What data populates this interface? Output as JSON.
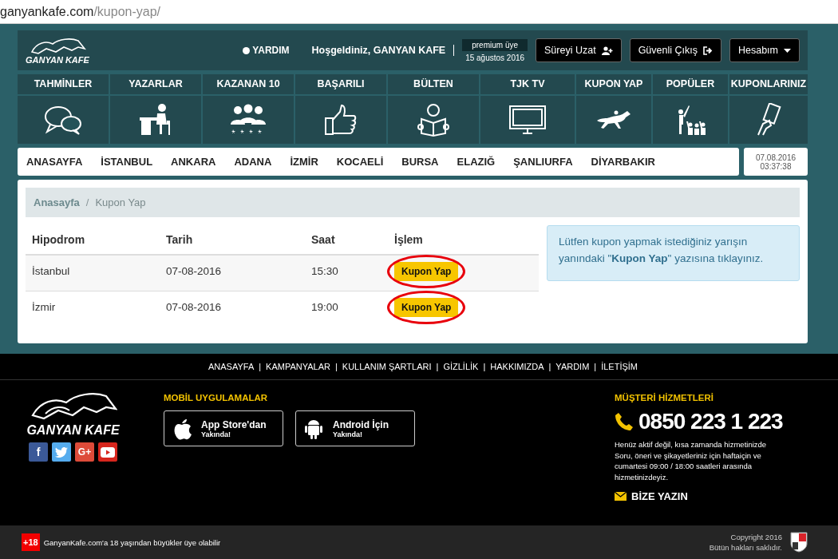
{
  "address_bar": {
    "domain": "ganyankafe.com",
    "path": "/kupon-yap/"
  },
  "header": {
    "logo": "GANYAN KAFE",
    "help": "YARDIM",
    "welcome": "Hoşgeldiniz, GANYAN KAFE",
    "membership": {
      "plan": "premium üye",
      "expires": "15 ağustos 2016"
    },
    "buttons": [
      {
        "label": "Süreyi Uzat",
        "kind": "user-plus"
      },
      {
        "label": "Güvenli Çıkış",
        "kind": "sign-out"
      },
      {
        "label": "Hesabım",
        "kind": "dropdown"
      }
    ]
  },
  "categories": [
    {
      "label": "TAHMİNLER",
      "kind": "chat"
    },
    {
      "label": "YAZARLAR",
      "kind": "writer"
    },
    {
      "label": "KAZANAN 10",
      "kind": "group"
    },
    {
      "label": "BAŞARILI",
      "kind": "thumb"
    },
    {
      "label": "BÜLTEN",
      "kind": "reader"
    },
    {
      "label": "TJK TV",
      "kind": "tv"
    },
    {
      "label": "KUPON YAP",
      "kind": "horse"
    },
    {
      "label": "POPÜLER",
      "kind": "crowd"
    },
    {
      "label": "KUPONLARINIZ",
      "kind": "card"
    }
  ],
  "city_nav": {
    "items": [
      "ANASAYFA",
      "İSTANBUL",
      "ANKARA",
      "ADANA",
      "İZMİR",
      "KOCAELİ",
      "BURSA",
      "ELAZIĞ",
      "ŞANLIURFA",
      "DİYARBAKIR"
    ],
    "date": "07.08.2016",
    "time": "03:37:38"
  },
  "breadcrumb": [
    {
      "label": "Anasayfa",
      "current": false
    },
    {
      "label": "Kupon Yap",
      "current": true
    }
  ],
  "breadcrumb_separator": "/",
  "table": {
    "columns": [
      "Hipodrom",
      "Tarih",
      "Saat",
      "İşlem"
    ],
    "rows": [
      {
        "hipodrom": "İstanbul",
        "tarih": "07-08-2016",
        "saat": "15:30",
        "action": "Kupon Yap",
        "circled": true
      },
      {
        "hipodrom": "İzmir",
        "tarih": "07-08-2016",
        "saat": "19:00",
        "action": "Kupon Yap",
        "circled": true
      }
    ]
  },
  "info": "Lütfen kupon yapmak istediğiniz yarışın yanındaki \"**Kupon Yap**\" yazısına tıklayınız.",
  "footer": {
    "links": [
      "ANASAYFA",
      "KAMPANYALAR",
      "KULLANIM ŞARTLARI",
      "GİZLİLİK",
      "HAKKIMIZDA",
      "YARDIM",
      "İLETİŞİM"
    ],
    "separator": "|",
    "logo": "GANYAN KAFE",
    "social": [
      {
        "kind": "facebook",
        "label": "f"
      },
      {
        "kind": "twitter"
      },
      {
        "kind": "google-plus",
        "label": "G+"
      },
      {
        "kind": "youtube"
      }
    ],
    "apps_title": "MOBİL UYGULAMALAR",
    "apps": [
      {
        "kind": "apple",
        "title": "App Store'dan",
        "note": "Yakında!"
      },
      {
        "kind": "android",
        "title": "Android İçin",
        "note": "Yakında!"
      }
    ],
    "support": {
      "title": "MÜŞTERİ HİZMETLERİ",
      "phone": "0850 223 1 223",
      "notice": "Henüz aktif değil, kısa zamanda hizmetinizde",
      "hours": "Soru, öneri ve şikayetleriniz için haftaiçin ve cumartesi 09:00 / 18:00 saatleri arasında hizmetinizdeyiz.",
      "contact": "BİZE YAZIN"
    }
  },
  "bottom": {
    "age_badge": "+18",
    "age_note": "GanyanKafe.com'a 18 yaşından büyükler üye olabilir",
    "copyright": "Copyright 2016",
    "rights": "Bütün hakları saklıdır."
  }
}
